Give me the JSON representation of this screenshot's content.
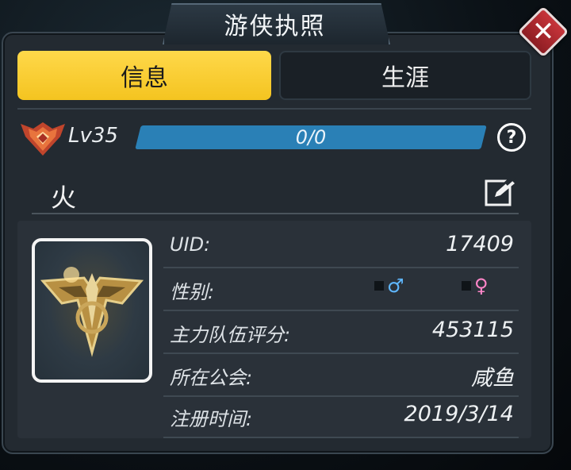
{
  "window": {
    "title": "游侠执照",
    "close_symbol": "✕"
  },
  "tabs": [
    {
      "label": "信息",
      "active": true
    },
    {
      "label": "生涯",
      "active": false
    }
  ],
  "level": {
    "label": "Lv35",
    "xp_text": "0/0",
    "help_symbol": "?"
  },
  "player": {
    "name": "火"
  },
  "info": {
    "uid": {
      "label": "UID:",
      "value": "17409"
    },
    "gender": {
      "label": "性别:",
      "male_symbol": "♂",
      "female_symbol": "♀"
    },
    "team_score": {
      "label": "主力队伍评分:",
      "value": "453115"
    },
    "guild": {
      "label": "所在公会:",
      "value": "咸鱼"
    },
    "register_time": {
      "label": "注册时间:",
      "value": "2019/3/14"
    }
  },
  "colors": {
    "accent_yellow": "#f7cb2f",
    "xp_bar": "#2a80b6",
    "male": "#5fb7ff",
    "female": "#ff86c9",
    "close_red": "#b8282f"
  },
  "icons": [
    "rank-emblem-icon",
    "help-icon",
    "edit-icon",
    "close-icon",
    "male-icon",
    "female-icon"
  ]
}
